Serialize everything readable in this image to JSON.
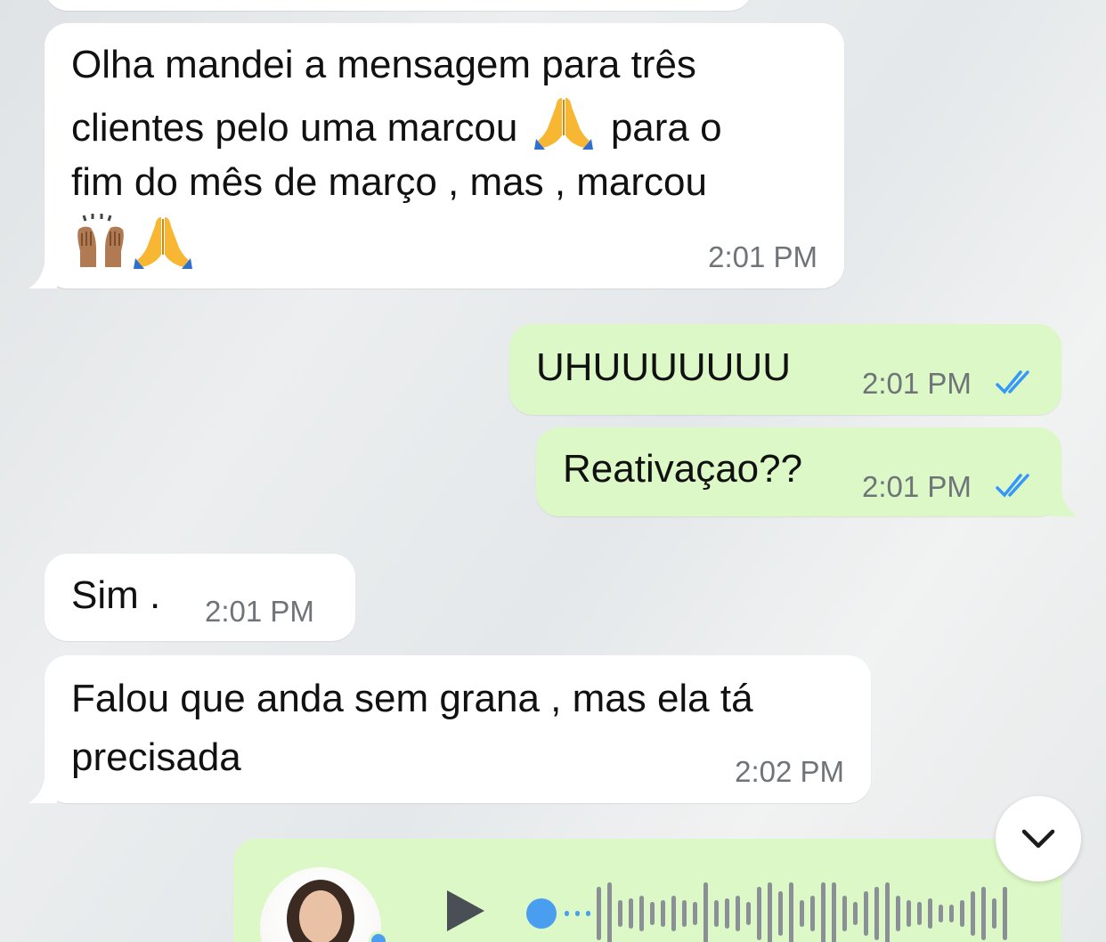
{
  "messages": [
    {
      "id": "m1",
      "direction": "incoming",
      "lines": [
        "Olha mandei a mensagem para três",
        "clientes pelo uma marcou",
        "para o",
        "fim do mês de março , mas , marcou"
      ],
      "emojis": [
        "folded-hands",
        "raising-hands",
        "folded-hands"
      ],
      "time": "2:01 PM"
    },
    {
      "id": "m2",
      "direction": "outgoing",
      "text": "UHUUUUUUU",
      "time": "2:01 PM",
      "status": "read"
    },
    {
      "id": "m3",
      "direction": "outgoing",
      "text": "Reativaçao??",
      "time": "2:01 PM",
      "status": "read"
    },
    {
      "id": "m4",
      "direction": "incoming",
      "text": "Sim .",
      "time": "2:01 PM"
    },
    {
      "id": "m5",
      "direction": "incoming",
      "lines": [
        "Falou que anda sem grana , mas ela tá",
        "precisada"
      ],
      "time": "2:02 PM"
    }
  ],
  "voice_message": {
    "direction": "outgoing",
    "icons": [
      "avatar",
      "play-icon",
      "waveform"
    ]
  },
  "scroll_button": {
    "icon": "chevron-down-icon"
  },
  "colors": {
    "incoming": "#ffffff",
    "outgoing": "#dcf8c6",
    "read_ticks": "#3497f9",
    "time": "#6f7479"
  }
}
